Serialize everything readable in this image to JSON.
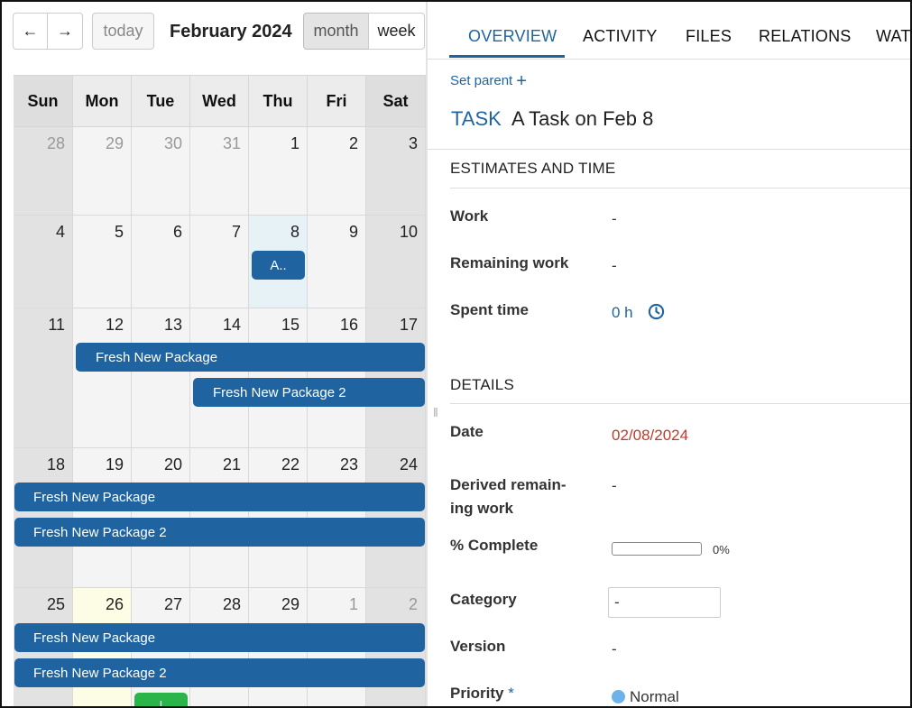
{
  "calendar": {
    "prev_label": "←",
    "next_label": "→",
    "today_label": "today",
    "title": "February 2024",
    "view_month": "month",
    "view_week": "week",
    "weekdays": [
      "Sun",
      "Mon",
      "Tue",
      "Wed",
      "Thu",
      "Fri",
      "Sat"
    ],
    "weeks": [
      [
        "28",
        "29",
        "30",
        "31",
        "1",
        "2",
        "3"
      ],
      [
        "4",
        "5",
        "6",
        "7",
        "8",
        "9",
        "10"
      ],
      [
        "11",
        "12",
        "13",
        "14",
        "15",
        "16",
        "17"
      ],
      [
        "18",
        "19",
        "20",
        "21",
        "22",
        "23",
        "24"
      ],
      [
        "25",
        "26",
        "27",
        "28",
        "29",
        "1",
        "2"
      ]
    ],
    "events": {
      "feb8_short": "A..",
      "pkg1": "Fresh New Package",
      "pkg2": "Fresh New Package 2",
      "green_short": "|"
    }
  },
  "tabs": [
    "OVERVIEW",
    "ACTIVITY",
    "FILES",
    "RELATIONS",
    "WATC"
  ],
  "header": {
    "set_parent": "Set parent",
    "type": "TASK",
    "subject": "A Task on Feb 8"
  },
  "estimates": {
    "title": "ESTIMATES AND TIME",
    "work_label": "Work",
    "work_value": "-",
    "remaining_label": "Remaining work",
    "remaining_value": "-",
    "spent_label": "Spent time",
    "spent_value": "0 h"
  },
  "details": {
    "title": "DETAILS",
    "date_label": "Date",
    "date_value": "02/08/2024",
    "derived_label_1": "Derived remain-",
    "derived_label_2": "ing work",
    "derived_value": "-",
    "complete_label": "% Complete",
    "complete_value": "0%",
    "complete_fraction": 0,
    "category_label": "Category",
    "category_value": "-",
    "version_label": "Version",
    "version_value": "-",
    "priority_label": "Priority",
    "priority_required": "*",
    "priority_value": "Normal"
  },
  "colors": {
    "accent": "#1f64a1",
    "date_red": "#c0392b",
    "event_green": "#2bb44a",
    "priority_normal": "#6db3ea"
  }
}
